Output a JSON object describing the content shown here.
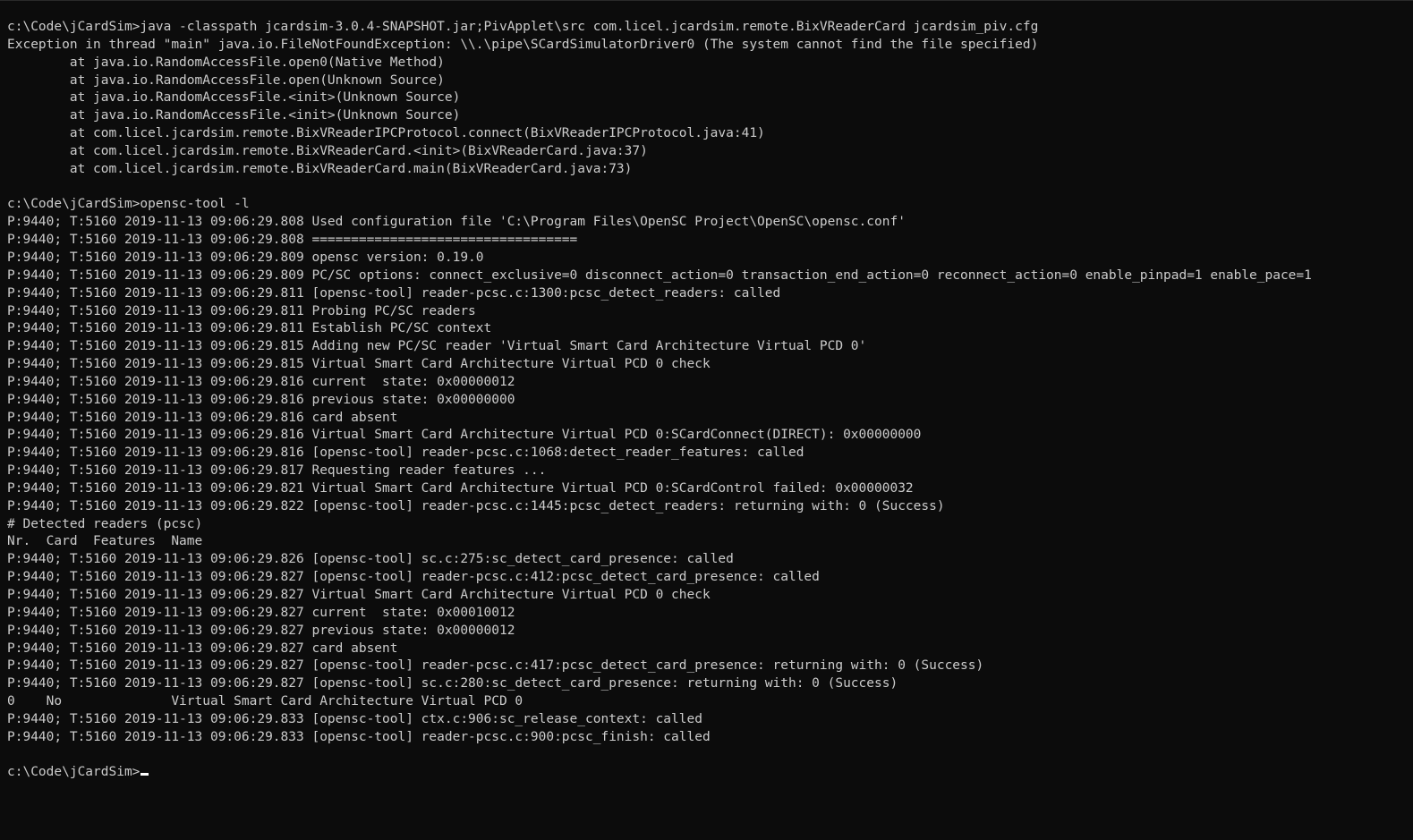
{
  "console": {
    "lines": [
      "c:\\Code\\jCardSim>java -classpath jcardsim-3.0.4-SNAPSHOT.jar;PivApplet\\src com.licel.jcardsim.remote.BixVReaderCard jcardsim_piv.cfg",
      "Exception in thread \"main\" java.io.FileNotFoundException: \\\\.\\pipe\\SCardSimulatorDriver0 (The system cannot find the file specified)",
      "        at java.io.RandomAccessFile.open0(Native Method)",
      "        at java.io.RandomAccessFile.open(Unknown Source)",
      "        at java.io.RandomAccessFile.<init>(Unknown Source)",
      "        at java.io.RandomAccessFile.<init>(Unknown Source)",
      "        at com.licel.jcardsim.remote.BixVReaderIPCProtocol.connect(BixVReaderIPCProtocol.java:41)",
      "        at com.licel.jcardsim.remote.BixVReaderCard.<init>(BixVReaderCard.java:37)",
      "        at com.licel.jcardsim.remote.BixVReaderCard.main(BixVReaderCard.java:73)",
      "",
      "c:\\Code\\jCardSim>opensc-tool -l",
      "P:9440; T:5160 2019-11-13 09:06:29.808 Used configuration file 'C:\\Program Files\\OpenSC Project\\OpenSC\\opensc.conf'",
      "P:9440; T:5160 2019-11-13 09:06:29.808 ==================================",
      "P:9440; T:5160 2019-11-13 09:06:29.809 opensc version: 0.19.0",
      "P:9440; T:5160 2019-11-13 09:06:29.809 PC/SC options: connect_exclusive=0 disconnect_action=0 transaction_end_action=0 reconnect_action=0 enable_pinpad=1 enable_pace=1",
      "P:9440; T:5160 2019-11-13 09:06:29.811 [opensc-tool] reader-pcsc.c:1300:pcsc_detect_readers: called",
      "P:9440; T:5160 2019-11-13 09:06:29.811 Probing PC/SC readers",
      "P:9440; T:5160 2019-11-13 09:06:29.811 Establish PC/SC context",
      "P:9440; T:5160 2019-11-13 09:06:29.815 Adding new PC/SC reader 'Virtual Smart Card Architecture Virtual PCD 0'",
      "P:9440; T:5160 2019-11-13 09:06:29.815 Virtual Smart Card Architecture Virtual PCD 0 check",
      "P:9440; T:5160 2019-11-13 09:06:29.816 current  state: 0x00000012",
      "P:9440; T:5160 2019-11-13 09:06:29.816 previous state: 0x00000000",
      "P:9440; T:5160 2019-11-13 09:06:29.816 card absent",
      "P:9440; T:5160 2019-11-13 09:06:29.816 Virtual Smart Card Architecture Virtual PCD 0:SCardConnect(DIRECT): 0x00000000",
      "P:9440; T:5160 2019-11-13 09:06:29.816 [opensc-tool] reader-pcsc.c:1068:detect_reader_features: called",
      "P:9440; T:5160 2019-11-13 09:06:29.817 Requesting reader features ...",
      "P:9440; T:5160 2019-11-13 09:06:29.821 Virtual Smart Card Architecture Virtual PCD 0:SCardControl failed: 0x00000032",
      "P:9440; T:5160 2019-11-13 09:06:29.822 [opensc-tool] reader-pcsc.c:1445:pcsc_detect_readers: returning with: 0 (Success)",
      "# Detected readers (pcsc)",
      "Nr.  Card  Features  Name",
      "P:9440; T:5160 2019-11-13 09:06:29.826 [opensc-tool] sc.c:275:sc_detect_card_presence: called",
      "P:9440; T:5160 2019-11-13 09:06:29.827 [opensc-tool] reader-pcsc.c:412:pcsc_detect_card_presence: called",
      "P:9440; T:5160 2019-11-13 09:06:29.827 Virtual Smart Card Architecture Virtual PCD 0 check",
      "P:9440; T:5160 2019-11-13 09:06:29.827 current  state: 0x00010012",
      "P:9440; T:5160 2019-11-13 09:06:29.827 previous state: 0x00000012",
      "P:9440; T:5160 2019-11-13 09:06:29.827 card absent",
      "P:9440; T:5160 2019-11-13 09:06:29.827 [opensc-tool] reader-pcsc.c:417:pcsc_detect_card_presence: returning with: 0 (Success)",
      "P:9440; T:5160 2019-11-13 09:06:29.827 [opensc-tool] sc.c:280:sc_detect_card_presence: returning with: 0 (Success)",
      "0    No              Virtual Smart Card Architecture Virtual PCD 0",
      "P:9440; T:5160 2019-11-13 09:06:29.833 [opensc-tool] ctx.c:906:sc_release_context: called",
      "P:9440; T:5160 2019-11-13 09:06:29.833 [opensc-tool] reader-pcsc.c:900:pcsc_finish: called",
      ""
    ],
    "prompt": "c:\\Code\\jCardSim>"
  },
  "colors": {
    "background": "#0c0c0c",
    "text": "#cccccc",
    "cursor": "#ffffff"
  }
}
